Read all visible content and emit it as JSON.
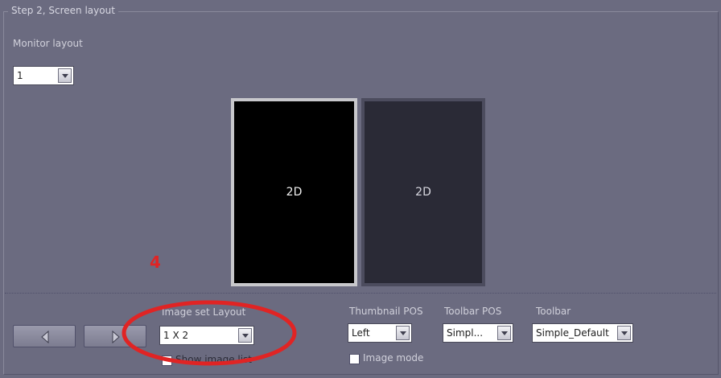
{
  "group": {
    "title": "Step 2, Screen layout"
  },
  "monitor_layout": {
    "label": "Monitor layout",
    "value": "1"
  },
  "monitors": [
    {
      "label": "2D"
    },
    {
      "label": "2D"
    }
  ],
  "image_set_layout": {
    "label": "Image set Layout",
    "value": "1 X 2",
    "checkbox_label": "Show image list"
  },
  "thumbnail_pos": {
    "label": "Thumbnail POS",
    "value": "Left"
  },
  "toolbar_pos": {
    "label": "Toolbar POS",
    "value": "Simpl..."
  },
  "toolbar": {
    "label": "Toolbar",
    "value": "Simple_Default"
  },
  "image_mode": {
    "label": "Image mode"
  },
  "annotation": {
    "number": "4",
    "color": "#e02424"
  },
  "colors": {
    "panel": "#6b6b80",
    "monitor_selected": "#000000",
    "monitor_other": "#2a2a36"
  }
}
